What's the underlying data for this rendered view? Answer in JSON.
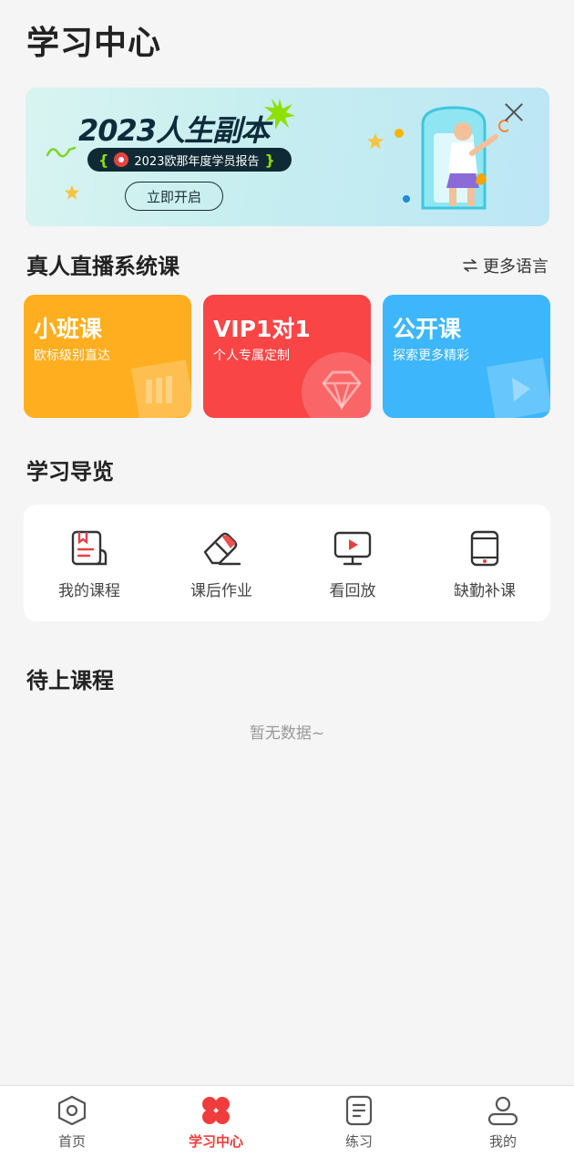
{
  "header": {
    "title": "学习中心"
  },
  "banner": {
    "title": "2023人生副本",
    "pill_text": "2023欧那年度学员报告",
    "button_label": "立即开启",
    "colors": {
      "bg_start": "#d9f4f1",
      "bg_end": "#bde6f6",
      "pill_bg": "#0f2a34",
      "accent": "#8ee000"
    }
  },
  "live_section": {
    "title": "真人直播系统课",
    "more_label": "更多语言",
    "cards": [
      {
        "title": "小班课",
        "subtitle": "欧标级别直达",
        "color": "#ffae1f",
        "icon": "books-icon"
      },
      {
        "title": "VIP1对1",
        "subtitle": "个人专属定制",
        "color": "#f94546",
        "icon": "diamond-icon"
      },
      {
        "title": "公开课",
        "subtitle": "探索更多精彩",
        "color": "#3db6fb",
        "icon": "play-box-icon"
      }
    ]
  },
  "guide_section": {
    "title": "学习导览",
    "items": [
      {
        "label": "我的课程",
        "icon": "notebook-icon"
      },
      {
        "label": "课后作业",
        "icon": "eraser-icon"
      },
      {
        "label": "看回放",
        "icon": "monitor-play-icon"
      },
      {
        "label": "缺勤补课",
        "icon": "tablet-icon"
      }
    ]
  },
  "upcoming_section": {
    "title": "待上课程",
    "empty_text": "暂无数据~"
  },
  "bottom_nav": {
    "items": [
      {
        "label": "首页",
        "icon": "home-icon",
        "active": false
      },
      {
        "label": "学习中心",
        "icon": "clover-icon",
        "active": true
      },
      {
        "label": "练习",
        "icon": "document-icon",
        "active": false
      },
      {
        "label": "我的",
        "icon": "user-icon",
        "active": false
      }
    ],
    "active_color": "#f03c3c"
  }
}
